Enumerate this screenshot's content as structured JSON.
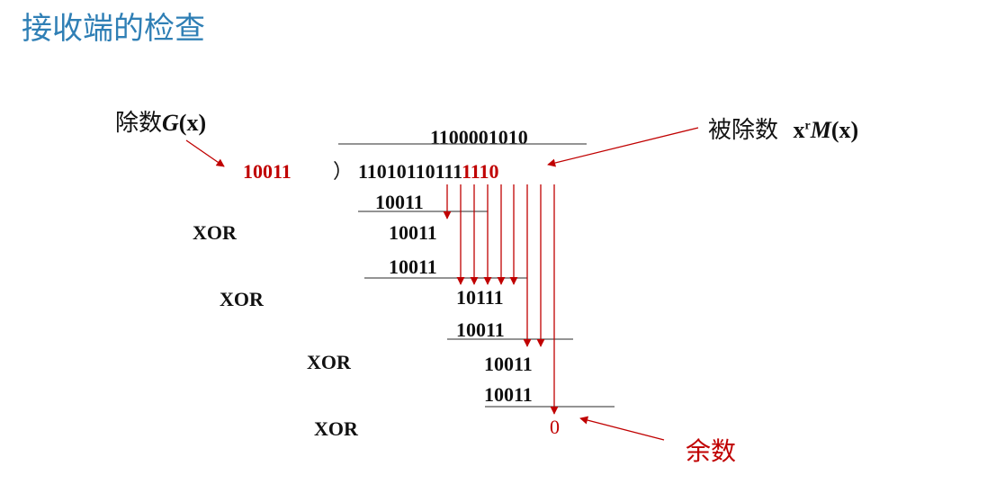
{
  "title": "接收端的检查",
  "divisor_label": {
    "text": "除数",
    "symbol": "G",
    "arg": "(x)"
  },
  "dividend_label": {
    "text": "被除数",
    "prefix": "x",
    "sup": "r",
    "symbol": "M",
    "arg": "(x)"
  },
  "remainder_label": "余数",
  "divisor": "10011",
  "paren": "）",
  "quotient": "1100001010",
  "dividend_black": "11010110111",
  "dividend_red": "1110",
  "steps": [
    {
      "subtract": "10011",
      "result": "10011"
    },
    {
      "subtract": "10011",
      "result": "10111"
    },
    {
      "subtract": "10011",
      "result": "10011"
    },
    {
      "subtract": "10011",
      "result": "0"
    }
  ],
  "xor": [
    "XOR",
    "XOR",
    "XOR",
    "XOR"
  ],
  "colors": {
    "title": "#2f7fb5",
    "highlight": "#c00000",
    "text": "#111111",
    "rule": "#555555"
  }
}
